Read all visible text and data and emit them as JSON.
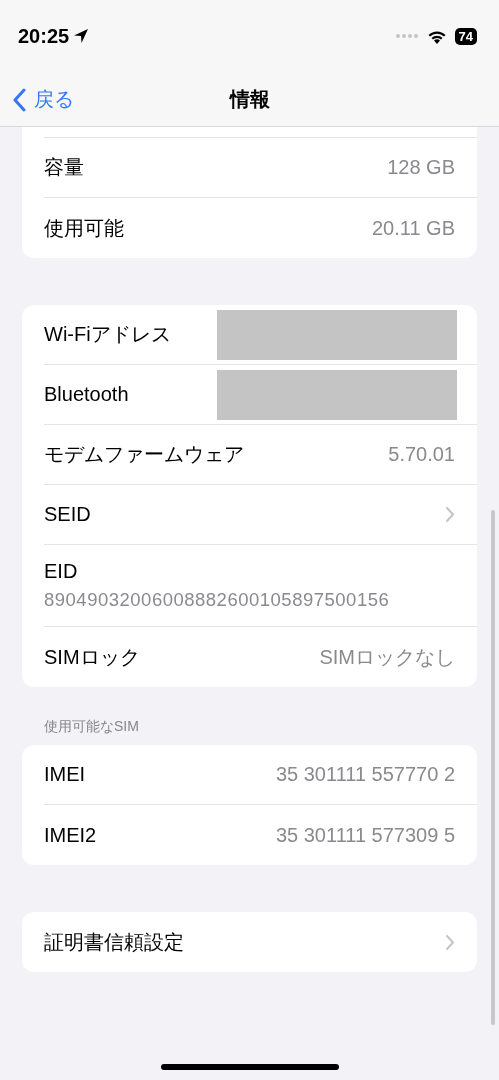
{
  "status_bar": {
    "time": "20:25",
    "battery": "74"
  },
  "nav": {
    "back": "戻る",
    "title": "情報"
  },
  "groups": [
    {
      "cut_top": true,
      "rows": [
        {
          "kind": "value",
          "label": "容量",
          "value": "128 GB"
        },
        {
          "kind": "value",
          "label": "使用可能",
          "value": "20.11 GB"
        }
      ]
    },
    {
      "cut_top": false,
      "rows": [
        {
          "kind": "redacted",
          "label": "Wi-Fiアドレス"
        },
        {
          "kind": "redacted",
          "label": "Bluetooth"
        },
        {
          "kind": "value",
          "label": "モデムファームウェア",
          "value": "5.70.01"
        },
        {
          "kind": "chevron",
          "label": "SEID"
        },
        {
          "kind": "stacked",
          "label": "EID",
          "value": "89049032006008882600105897500156"
        },
        {
          "kind": "value",
          "label": "SIMロック",
          "value": "SIMロックなし"
        }
      ]
    },
    {
      "header": "使用可能なSIM",
      "cut_top": false,
      "rows": [
        {
          "kind": "value",
          "label": "IMEI",
          "value": "35 301111 557770 2"
        },
        {
          "kind": "value",
          "label": "IMEI2",
          "value": "35 301111 577309 5"
        }
      ]
    },
    {
      "cut_top": false,
      "rows": [
        {
          "kind": "chevron",
          "label": "証明書信頼設定"
        }
      ]
    }
  ]
}
